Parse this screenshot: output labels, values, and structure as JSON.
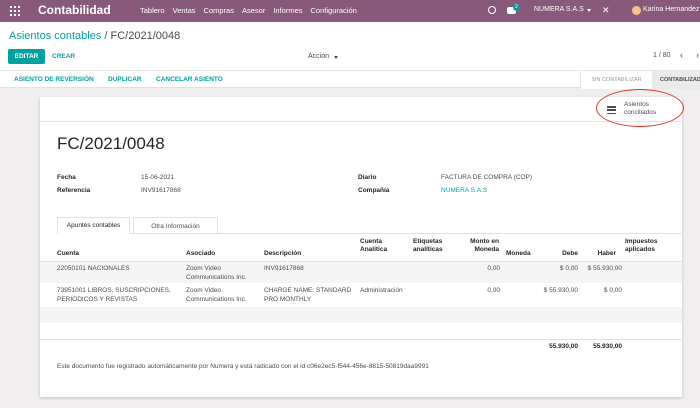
{
  "navbar": {
    "brand": "Contabilidad",
    "menu": [
      "Tablero",
      "Ventas",
      "Compras",
      "Asesor",
      "Informes",
      "Configuración"
    ],
    "chat_count": "2",
    "company": "NUMERA S.A.S",
    "user": "Karina Hernandez",
    "brand_color": "#875a7b",
    "accent_color": "#00a09d"
  },
  "control": {
    "breadcrumb_parent": "Asientos contables",
    "breadcrumb_sep": " / ",
    "breadcrumb_current": "FC/2021/0048",
    "edit_label": "EDITAR",
    "create_label": "CREAR",
    "action_label": "Acción",
    "pager": "1 / 80",
    "prev_icon": "‹",
    "next_icon": "›",
    "buttons": [
      "ASIENTO DE REVERSIÓN",
      "DUPLICAR",
      "CANCELAR ASIENTO"
    ],
    "stages": [
      "SIN CONTABILIZAR",
      "CONTABILIZADO"
    ]
  },
  "sheet": {
    "reconciled_label": "Asientos conciliados",
    "title": "FC/2021/0048",
    "fields": {
      "fecha_label": "Fecha",
      "fecha_value": "15-06-2021",
      "referencia_label": "Referencia",
      "referencia_value": "INV91617868",
      "diario_label": "Diario",
      "diario_value": "FACTURA DE COMPRA (COP)",
      "compania_label": "Compañía",
      "compania_value": "NUMERA S.A.S"
    },
    "tabs": [
      "Apuntes contables",
      "Otra Información"
    ],
    "table": {
      "headers": {
        "cuenta": "Cuenta",
        "asociado": "Asociado",
        "descripcion": "Descripción",
        "cuenta_analitica": "Cuenta Analítica",
        "etiquetas": "Etiquetas analíticas",
        "monto_moneda": "Monto en Moneda",
        "moneda": "Moneda",
        "debe": "Debe",
        "haber": "Haber",
        "impuestos": "Impuestos aplicados"
      },
      "rows": [
        {
          "cuenta": "22050101 NACIONALES",
          "asociado": "Zoom Video Communications Inc.",
          "descripcion": "INV91617868",
          "cuenta_analitica": "",
          "monto_moneda": "0,00",
          "debe": "$ 0,00",
          "haber": "$ 55.930,00"
        },
        {
          "cuenta": "73951001 LIBROS, SUSCRIPCIONES, PERIODICOS Y REVISTAS",
          "asociado": "Zoom Video Communications Inc.",
          "descripcion": "CHARGE NAME: STANDARD PRO MONTHLY",
          "cuenta_analitica": "Administración",
          "monto_moneda": "0,00",
          "debe": "$ 55.930,00",
          "haber": "$ 0,00"
        }
      ],
      "total_debe": "55.930,00",
      "total_haber": "55.930,00"
    },
    "note": "Este documento fue registrado automáticamente por Numera y está radicado con el id c06e2ec5-f544-456e-8815-50819daa9991"
  }
}
